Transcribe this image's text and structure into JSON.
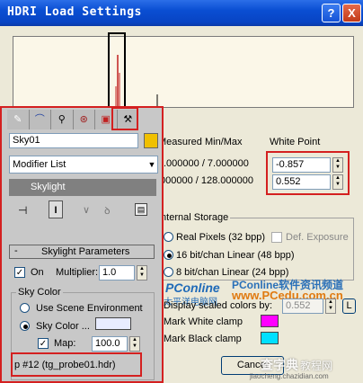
{
  "window": {
    "title": "HDRI Load Settings",
    "help_glyph": "?",
    "close_glyph": "X"
  },
  "right": {
    "measured_label": "Measured Min/Max",
    "measured_min_max": ".000000 / 7.000000",
    "measured_min_max2": "000000 / 128.000000",
    "white_point_label": "White Point",
    "white_point_1": "-0.857",
    "white_point_2": "0.552",
    "internal_storage_label": "Internal Storage",
    "real_pixels": "Real Pixels (32 bpp)",
    "def_exposure": "Def. Exposure",
    "linear16": "16 bit/chan Linear (48 bpp)",
    "linear8": "8 bit/chan Linear (24 bpp)",
    "display_scaled": "Display scaled colors by:",
    "display_value": "0.552",
    "l_button": "L",
    "mark_white": "Mark White clamp",
    "mark_black": "Mark Black clamp",
    "cancel": "Cancel"
  },
  "panel": {
    "name_field": "Sky01",
    "modifier_list": "Modifier List",
    "stack_item": "Skylight",
    "rollout_title": "Skylight Parameters",
    "minus": "-",
    "on_label": "On",
    "multiplier_label": "Multiplier:",
    "multiplier_value": "1.0",
    "sky_color_group": "Sky Color",
    "use_scene_env": "Use Scene Environment",
    "sky_color_label": "Sky Color ...",
    "map_label": "Map:",
    "map_value": "100.0",
    "map_button": "p #12 (tg_probe01.hdr)"
  },
  "watermarks": [
    "PConline",
    "太平洋电脑网",
    "PConline软件资讯频道",
    "www.PCedu.com.cn",
    "查字典",
    "教程网",
    "jiaocheng.chazidian.com"
  ],
  "colors": {
    "white_clamp": "#ff00ff",
    "black_clamp": "#00e0ff",
    "highlight": "#d42020"
  }
}
